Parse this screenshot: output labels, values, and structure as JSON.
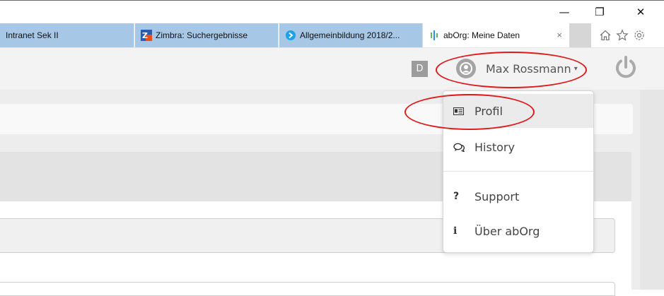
{
  "window": {
    "controls": {
      "minimize": "—",
      "restore": "❐",
      "close": "✕"
    }
  },
  "tabs": [
    {
      "label": "Intranet Sek II",
      "icon": "none"
    },
    {
      "label": "Zimbra: Suchergebnisse",
      "icon": "zimbra-icon"
    },
    {
      "label": "Allgemeinbildung 2018/2...",
      "icon": "arrow-circle-icon"
    },
    {
      "label": "abOrg: Meine Daten",
      "icon": "aborg-icon",
      "active": true,
      "close": "×"
    }
  ],
  "toolbar": {
    "icons": [
      "home-icon",
      "star-icon",
      "gear-icon"
    ]
  },
  "header": {
    "badge": "D",
    "user_name": "Max Rossmann",
    "caret": "▾"
  },
  "menu": {
    "items": [
      {
        "label": "Profil",
        "icon": "id-card-icon"
      },
      {
        "label": "History",
        "icon": "chat-icon"
      },
      {
        "label": "Support",
        "icon": "question-icon",
        "glyph": "?"
      },
      {
        "label": "Über abOrg",
        "icon": "info-icon",
        "glyph": "i"
      }
    ]
  },
  "colors": {
    "annotation": "#e0191b",
    "tab_inactive": "#a7c7e7",
    "header_bg": "#f3f3f3",
    "power": "#aaaaaa"
  }
}
